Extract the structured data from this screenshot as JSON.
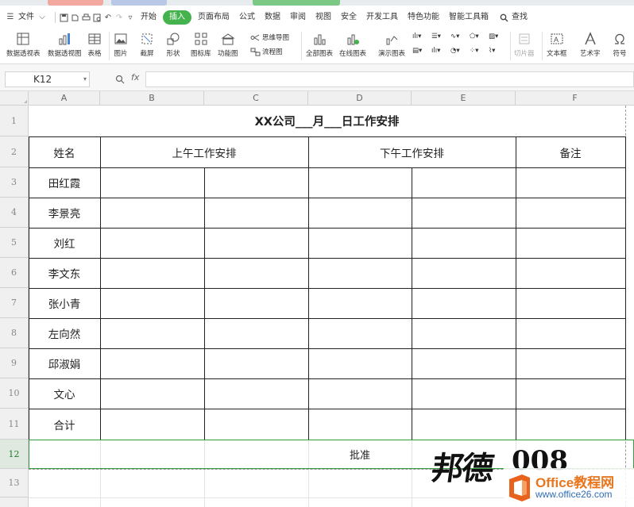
{
  "menu": {
    "file": "文件",
    "tabs": [
      "开始",
      "插入",
      "页面布局",
      "公式",
      "数据",
      "审阅",
      "视图",
      "安全",
      "开发工具",
      "特色功能",
      "智能工具箱"
    ],
    "active_tab": "插入",
    "search": "查找"
  },
  "ribbon": {
    "pivot_table": "数据透视表",
    "pivot_chart": "数据透视图",
    "table": "表格",
    "picture": "图片",
    "screenshot": "截屏",
    "shape": "形状",
    "icon_lib": "图标库",
    "func_chart": "功能图",
    "mindmap": "思维导图",
    "flowchart": "流程图",
    "all_charts": "全部图表",
    "online_charts": "在线图表",
    "demo_charts": "演示图表",
    "slicer": "切片器",
    "textbox": "文本框",
    "wordart": "艺术字",
    "symbol": "符号"
  },
  "formula_bar": {
    "name_box": "K12",
    "fx": "fx",
    "value": ""
  },
  "columns": [
    "A",
    "B",
    "C",
    "D",
    "E",
    "F"
  ],
  "rows": [
    "1",
    "2",
    "3",
    "4",
    "5",
    "6",
    "7",
    "8",
    "9",
    "10",
    "11",
    "12",
    "13"
  ],
  "sheet": {
    "title": "XX公司___月___日工作安排",
    "header_name": "姓名",
    "header_am": "上午工作安排",
    "header_pm": "下午工作安排",
    "header_note": "备注",
    "names": [
      "田红霞",
      "李景亮",
      "刘红",
      "李文东",
      "张小青",
      "左向然",
      "邱淑娟",
      "文心"
    ],
    "total": "合计",
    "approve": "批准"
  },
  "watermark": {
    "handwriting": "邦德",
    "number": "008",
    "brand": "Office教程网",
    "url": "www.office26.com"
  },
  "colors": {
    "accent": "#44b34e",
    "grid_border": "#222222",
    "header_bg": "#f0f0f0"
  }
}
